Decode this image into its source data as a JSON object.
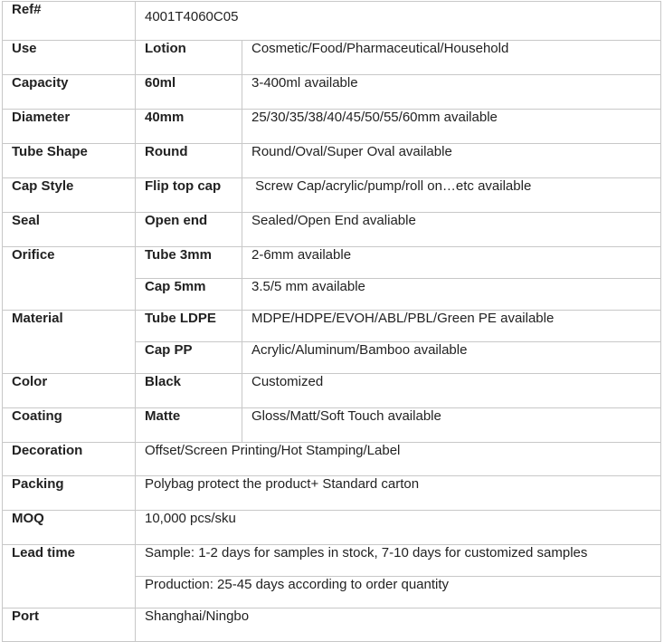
{
  "rows": {
    "ref": {
      "label": "Ref#",
      "value": "4001T4060C05"
    },
    "use": {
      "label": "Use",
      "spec": "Lotion",
      "available": "Cosmetic/Food/Pharmaceutical/Household"
    },
    "capacity": {
      "label": "Capacity",
      "spec": "60ml",
      "available": "3-400ml available"
    },
    "diameter": {
      "label": "Diameter",
      "spec": "40mm",
      "available": "25/30/35/38/40/45/50/55/60mm available"
    },
    "tube_shape": {
      "label": "Tube Shape",
      "spec": "Round",
      "available": "Round/Oval/Super Oval available"
    },
    "cap_style": {
      "label": "Cap Style",
      "spec": "Flip top cap",
      "available": " Screw Cap/acrylic/pump/roll on…etc available"
    },
    "seal": {
      "label": "Seal",
      "spec": "Open end",
      "available": "Sealed/Open End avaliable"
    },
    "orifice": {
      "label": "Orifice",
      "sub": [
        {
          "spec": "Tube 3mm",
          "available": "2-6mm available"
        },
        {
          "spec": "Cap 5mm",
          "available": "3.5/5 mm available"
        }
      ]
    },
    "material": {
      "label": "Material",
      "sub": [
        {
          "spec": "Tube LDPE",
          "available": "MDPE/HDPE/EVOH/ABL/PBL/Green PE available"
        },
        {
          "spec": "Cap PP",
          "available": "Acrylic/Aluminum/Bamboo available"
        }
      ]
    },
    "color": {
      "label": "Color",
      "spec": "Black",
      "available": "Customized"
    },
    "coating": {
      "label": "Coating",
      "spec": "Matte",
      "available": "Gloss/Matt/Soft Touch available"
    },
    "decoration": {
      "label": "Decoration",
      "value": "Offset/Screen Printing/Hot Stamping/Label"
    },
    "packing": {
      "label": "Packing",
      "value": "Polybag protect the product+ Standard carton"
    },
    "moq": {
      "label": "MOQ",
      "value": "10,000 pcs/sku"
    },
    "lead_time": {
      "label": "Lead time",
      "lines": [
        "Sample: 1-2 days for samples in stock, 7-10 days for customized samples",
        "Production: 25-45 days according to order quantity"
      ]
    },
    "port": {
      "label": "Port",
      "value": "Shanghai/Ningbo"
    }
  },
  "colors": {
    "label_text": "#4a80b8",
    "border": "#c8c8c8",
    "body_text": "#222222"
  }
}
